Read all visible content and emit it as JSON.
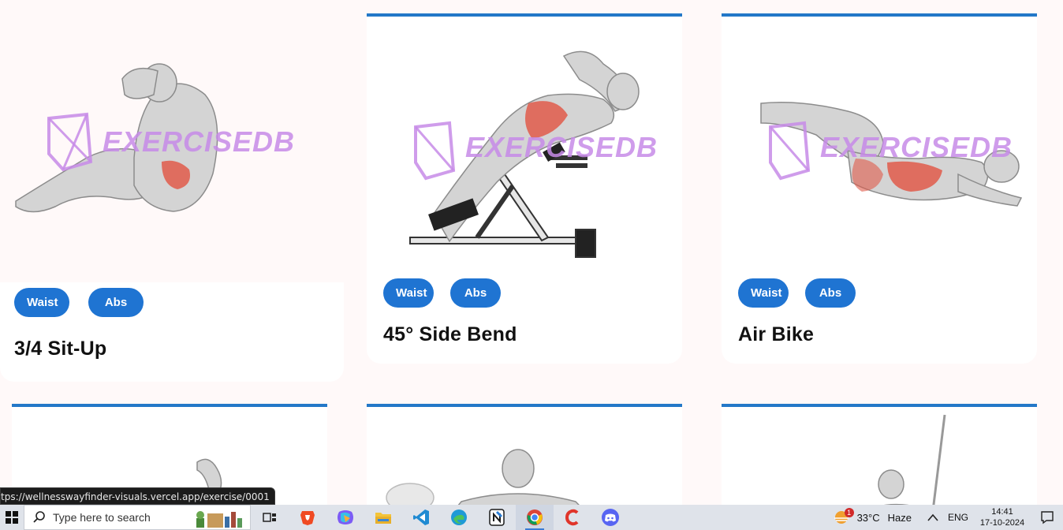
{
  "cards": [
    {
      "title": "3/4 Sit-Up",
      "tags": [
        "Waist",
        "Abs"
      ],
      "watermark": "EXERCISEDB"
    },
    {
      "title": "45° Side Bend",
      "tags": [
        "Waist",
        "Abs"
      ],
      "watermark": "EXERCISEDB"
    },
    {
      "title": "Air Bike",
      "tags": [
        "Waist",
        "Abs"
      ],
      "watermark": "EXERCISEDB"
    }
  ],
  "status_url": "tps://wellnesswayfinder-visuals.vercel.app/exercise/0001",
  "taskbar": {
    "search_placeholder": "Type here to search",
    "weather_temp": "33°C",
    "weather_desc": "Haze",
    "weather_badge": "1",
    "language": "ENG",
    "time": "14:41",
    "date": "17-10-2024"
  },
  "colors": {
    "accent": "#2378c8",
    "chip": "#1f74d2",
    "page_bg": "#fff9f9"
  }
}
